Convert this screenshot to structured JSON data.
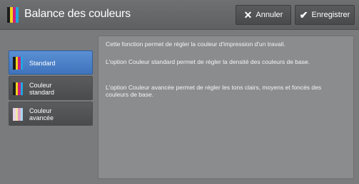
{
  "header": {
    "title": "Balance des couleurs",
    "cancel_label": "Annuler",
    "save_label": "Enregistrer",
    "cancel_icon": "close-icon",
    "save_icon": "check-icon"
  },
  "description": {
    "line1": "Cette fonction permet de régler la couleur d'impression d'un travail.",
    "line2": "L'option Couleur standard permet de régler la densité des couleurs de base.",
    "line3": "L'option Couleur avancée permet de régler les tons clairs, moyens et foncés des couleurs de base."
  },
  "menu": {
    "items": [
      {
        "label": "Standard",
        "selected": true
      },
      {
        "label": "Couleur\nstandard",
        "selected": false
      },
      {
        "label": "Couleur\navancée",
        "selected": false
      }
    ]
  },
  "colors": {
    "accent": "#3f74bd",
    "cyan": "#1ea7e1",
    "magenta": "#d21f7a",
    "yellow": "#f3d31b",
    "black": "#1b1b1b"
  }
}
